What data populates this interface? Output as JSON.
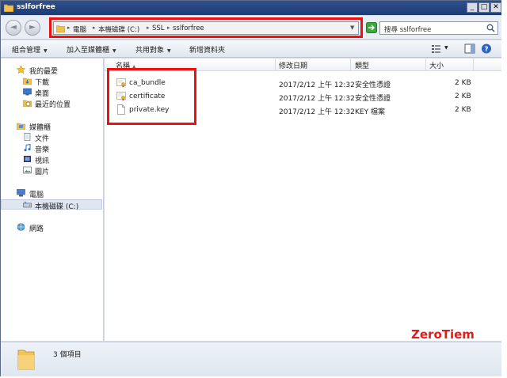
{
  "window": {
    "title": "sslforfree",
    "minimize": "_",
    "maximize": "□",
    "close": "✕"
  },
  "nav": {
    "back": "◄",
    "forward": "►",
    "breadcrumb": [
      "電腦",
      "本機磁碟 (C:)",
      "SSL",
      "sslforfree"
    ],
    "dropdown": "▼",
    "search_placeholder": "搜尋 sslforfree"
  },
  "toolbar": {
    "organize": "組合管理",
    "add_to_library": "加入至媒體櫃",
    "share_with": "共用對象",
    "new_folder": "新增資料夾",
    "dd": "▼"
  },
  "sidebar": {
    "favorites": "我的最愛",
    "downloads": "下載",
    "desktop": "桌面",
    "recent": "最近的位置",
    "libraries": "媒體櫃",
    "documents": "文件",
    "music": "音樂",
    "videos": "視訊",
    "pictures": "圖片",
    "computer": "電腦",
    "local_disk": "本機磁碟 (C:)",
    "network": "網路"
  },
  "columns": {
    "name": "名稱",
    "modified": "修改日期",
    "type": "類型",
    "size": "大小",
    "sort": "▲"
  },
  "files": [
    {
      "name": "ca_bundle",
      "modified": "2017/2/12 上午 12:32",
      "type": "安全性憑證",
      "size": "2 KB",
      "icon": "certificate-icon"
    },
    {
      "name": "certificate",
      "modified": "2017/2/12 上午 12:32",
      "type": "安全性憑證",
      "size": "2 KB",
      "icon": "certificate-icon"
    },
    {
      "name": "private.key",
      "modified": "2017/2/12 上午 12:32",
      "type": "KEY 檔案",
      "size": "2 KB",
      "icon": "file-icon"
    }
  ],
  "status": {
    "count": "3 個項目"
  },
  "watermark": "ZeroTiem",
  "colors": {
    "highlight": "#ee1010",
    "titlebar": "#2e4f8f",
    "watermark": "#e21b1b"
  }
}
